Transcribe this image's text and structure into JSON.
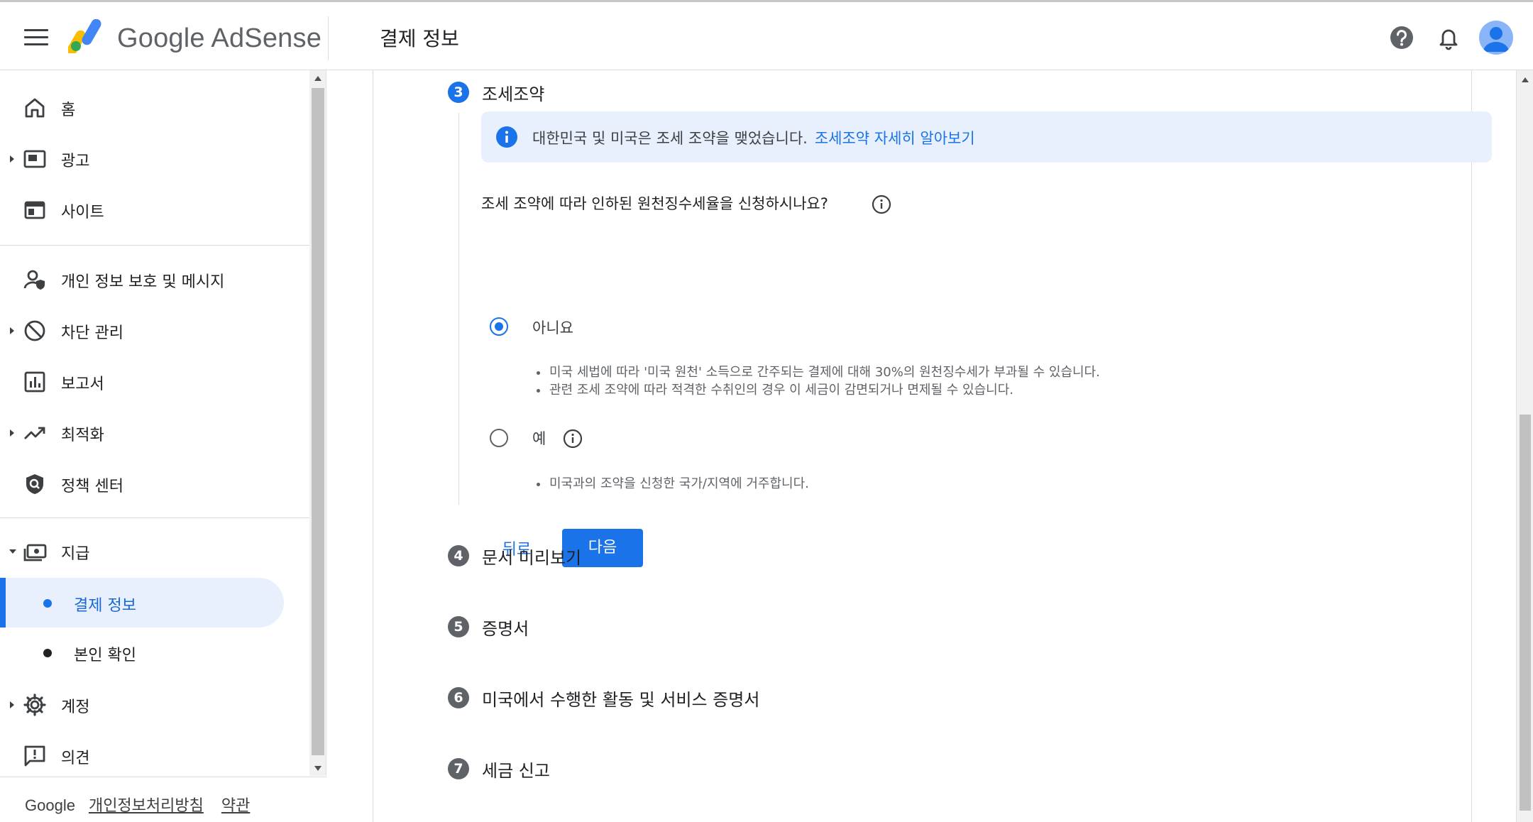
{
  "header": {
    "app_name": "Google AdSense",
    "page_title": "결제 정보"
  },
  "sidebar": {
    "items": [
      {
        "label": "홈",
        "icon": "home-icon",
        "expandable": false
      },
      {
        "label": "광고",
        "icon": "ads-icon",
        "expandable": true
      },
      {
        "label": "사이트",
        "icon": "sites-icon",
        "expandable": false
      },
      {
        "label": "개인 정보 보호 및 메시지",
        "icon": "privacy-messaging-icon",
        "expandable": false
      },
      {
        "label": "차단 관리",
        "icon": "block-icon",
        "expandable": true
      },
      {
        "label": "보고서",
        "icon": "reports-icon",
        "expandable": false
      },
      {
        "label": "최적화",
        "icon": "optimization-icon",
        "expandable": true
      },
      {
        "label": "정책 센터",
        "icon": "policy-center-icon",
        "expandable": false
      },
      {
        "label": "지급",
        "icon": "payments-icon",
        "expandable": true,
        "expanded": true
      },
      {
        "label": "계정",
        "icon": "account-icon",
        "expandable": true
      },
      {
        "label": "의견",
        "icon": "feedback-icon",
        "expandable": false
      }
    ],
    "sub_items": [
      {
        "label": "결제 정보",
        "active": true
      },
      {
        "label": "본인 확인",
        "active": false
      }
    ],
    "footer": {
      "brand": "Google",
      "privacy_link": "개인정보처리방침",
      "terms_link": "약관"
    }
  },
  "steps": {
    "current": {
      "number": "3",
      "title": "조세조약"
    },
    "upcoming": [
      {
        "number": "4",
        "title": "문서 미리보기"
      },
      {
        "number": "5",
        "title": "증명서"
      },
      {
        "number": "6",
        "title": "미국에서 수행한 활동 및 서비스 증명서"
      },
      {
        "number": "7",
        "title": "세금 신고"
      }
    ]
  },
  "treaty": {
    "info_text": "대한민국 및 미국은 조세 조약을 맺었습니다.",
    "info_link": "조세조약 자세히 알아보기",
    "question": "조세 조약에 따라 인하된 원천징수세율을 신청하시나요?",
    "options": [
      {
        "label": "아니요",
        "selected": true,
        "bullets": [
          "미국 세법에 따라 '미국 원천' 소득으로 간주되는 결제에 대해 30%의 원천징수세가 부과될 수 있습니다.",
          "관련 조세 조약에 따라 적격한 수취인의 경우 이 세금이 감면되거나 면제될 수 있습니다."
        ]
      },
      {
        "label": "예",
        "selected": false,
        "bullets": [
          "미국과의 조약을 신청한 국가/지역에 거주합니다."
        ]
      }
    ],
    "back_label": "뒤로",
    "next_label": "다음"
  },
  "colors": {
    "accent": "#1a73e8",
    "info_background": "#e8f0fe",
    "inactive_step": "#5f6368"
  }
}
